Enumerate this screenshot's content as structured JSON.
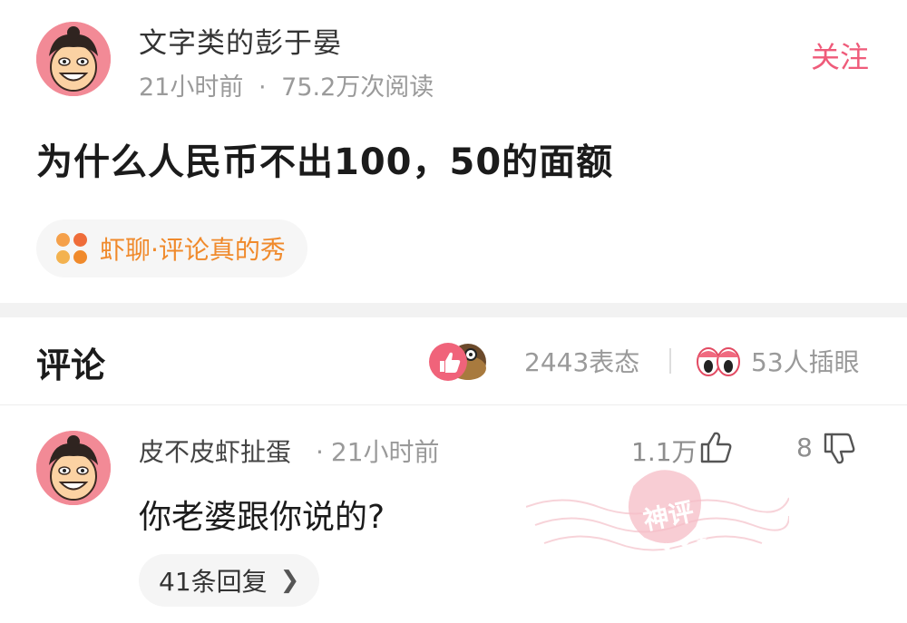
{
  "post": {
    "author": "文字类的彭于晏",
    "time": "21小时前",
    "meta_sep": "·",
    "views": "75.2万次阅读",
    "follow_label": "关注",
    "title": "为什么人民币不出100，50的面额",
    "topic_label": "虾聊·评论真的秀",
    "topic_icon_colors": [
      "#f5a04a",
      "#ef6d3a",
      "#f3b24f",
      "#f08a2c"
    ]
  },
  "comments_header": {
    "title": "评论",
    "reactions": "2443表态",
    "eyes": "53人插眼"
  },
  "comment": {
    "author": "皮不皮虾扯蛋",
    "meta_sep": "·",
    "time": "21小时前",
    "likes": "1.1万",
    "dislikes": "8",
    "text": "你老婆跟你说的?",
    "replies": "41条回复",
    "stamp_text": "神评"
  },
  "colors": {
    "accent": "#ef5b7a",
    "topic_orange": "#f08a2c",
    "muted": "#9a9a9a",
    "avatar_bg": "#f28a96"
  }
}
